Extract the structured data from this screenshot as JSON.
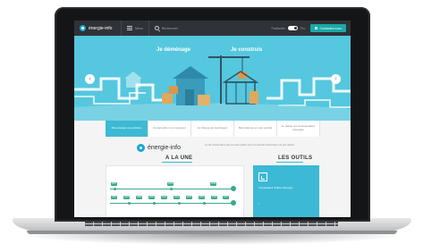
{
  "topbar": {
    "logo_text": "énergie-info",
    "menu_label": "Menu",
    "search_label": "Rechercher",
    "mode_label": "Particulier",
    "mode_label_alt": "Pro",
    "contact_label": "Contactez-nous"
  },
  "hero": {
    "title_left": "Je déménage",
    "title_right": "Je construis",
    "prev_glyph": "‹",
    "next_glyph": "›"
  },
  "tabs": [
    "Mon énergie au quotidien",
    "Comprendre mon compteur",
    "Je change de fournisseur",
    "Mes factures et mon contrat",
    "Je réduis ma consommation d'énergie"
  ],
  "intro": {
    "name": "énergie-info",
    "description": "Le site d'information des pouvoirs publics pour comprendre l'électricité et le gaz naturel."
  },
  "sections": {
    "une_title": "A LA UNE",
    "outils_title": "LES OUTILS"
  },
  "timeline": {
    "row1_chips": [
      "2007",
      "2015",
      "2018"
    ],
    "row2_chips": [
      "2007",
      "2008",
      "2009",
      "2010",
      "2011",
      "2012",
      "2013",
      "2014",
      "2016",
      "2017"
    ]
  },
  "outils": {
    "text": "Comparateur d'offres d'énergie",
    "more": "›"
  },
  "colors": {
    "topbar": "#2f3236",
    "hero_sky": "#55c7df",
    "accent": "#3cb9d5",
    "timeline": "#3aa88f"
  }
}
